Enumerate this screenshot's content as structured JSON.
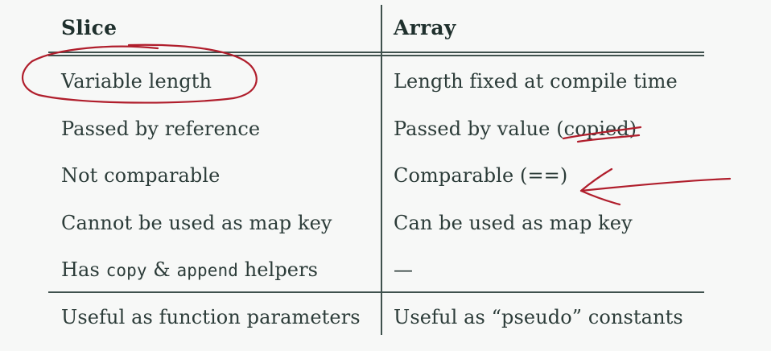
{
  "table": {
    "headers": {
      "left": "Slice",
      "right": "Array"
    },
    "rows": [
      {
        "left": "Variable length",
        "right": "Length fixed at compile time"
      },
      {
        "left": "Passed by reference",
        "right_prefix": "Passed by value ",
        "right_struck": "(copied)"
      },
      {
        "left": "Not comparable",
        "right": "Comparable (==)"
      },
      {
        "left": "Cannot be used as map key",
        "right": "Can be used as map key"
      },
      {
        "left_prefix": "Has ",
        "left_code1": "copy",
        "left_mid": " & ",
        "left_code2": "append",
        "left_suffix": " helpers",
        "right": "—"
      }
    ],
    "footer": {
      "left": "Useful as function parameters",
      "right": "Useful as “pseudo” constants"
    }
  },
  "annotations": {
    "ink_color": "#b01e2c",
    "marks": [
      "circle-around-variable-length",
      "strike-through-copied",
      "arrow-pointing-to-comparable"
    ]
  }
}
